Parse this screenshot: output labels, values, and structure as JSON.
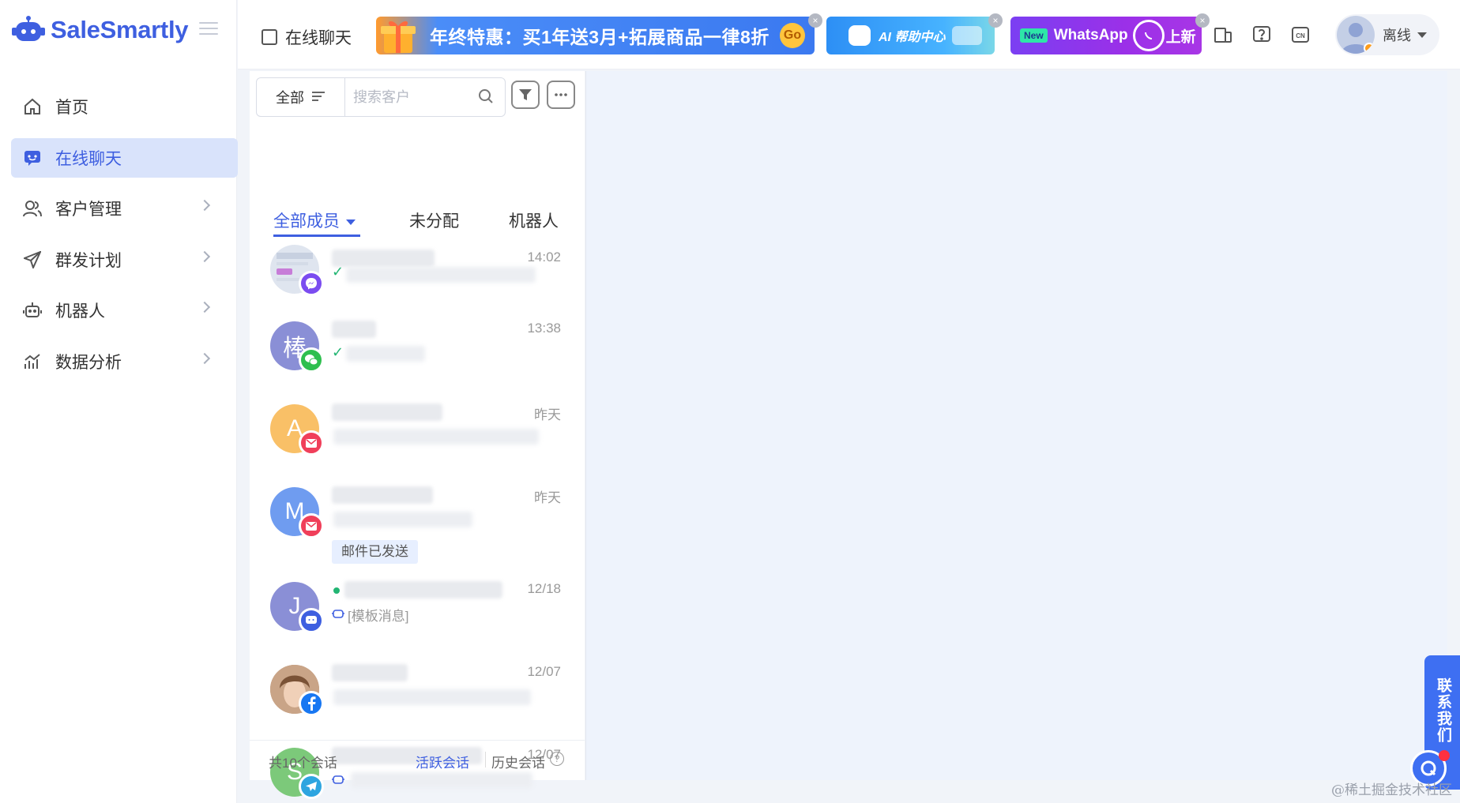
{
  "app": {
    "logo_text": "SaleSmartly",
    "accent_color": "#3e5fe0"
  },
  "sidebar": {
    "items": [
      {
        "label": "首页",
        "icon": "home-icon"
      },
      {
        "label": "在线聊天",
        "icon": "chat-icon",
        "active": true
      },
      {
        "label": "客户管理",
        "icon": "users-icon"
      },
      {
        "label": "群发计划",
        "icon": "send-icon"
      },
      {
        "label": "机器人",
        "icon": "robot-icon"
      },
      {
        "label": "数据分析",
        "icon": "chart-icon"
      }
    ]
  },
  "header": {
    "page_title": "在线聊天",
    "promo_banner": "年终特惠：买1年送3月+拓展商品一律8折",
    "promo_go": "Go",
    "ai_banner": "AI 帮助中心",
    "wa_new": "New",
    "wa_text": "WhatsApp",
    "wa_text2": "上新",
    "lang_badge": "CN",
    "user_status": "离线"
  },
  "conversation_panel": {
    "scope_label": "全部",
    "search_placeholder": "搜索客户",
    "tabs": [
      "全部成员",
      "未分配",
      "机器人"
    ],
    "conversations": [
      {
        "avatar_letter": "",
        "avatar_color": "#cfd8e8",
        "channel": "messenger-icon",
        "channel_color": "#7b4cf0",
        "time": "14:02",
        "status": "sent"
      },
      {
        "avatar_letter": "棒",
        "avatar_color": "#8a8fd6",
        "channel": "wechat-icon",
        "channel_color": "#2fbf4f",
        "time": "13:38",
        "status": "sent"
      },
      {
        "avatar_letter": "A",
        "avatar_color": "#f9c067",
        "channel": "email-icon",
        "channel_color": "#f03f5a",
        "time": "昨天"
      },
      {
        "avatar_letter": "M",
        "avatar_color": "#6f9cf0",
        "channel": "email-icon",
        "channel_color": "#f03f5a",
        "time": "昨天",
        "tag": "邮件已发送"
      },
      {
        "avatar_letter": "J",
        "avatar_color": "#8a8fd6",
        "channel": "chat-widget-icon",
        "channel_color": "#3e5fe0",
        "time": "12/18",
        "message": "[模板消息]"
      },
      {
        "avatar_letter": "",
        "avatar_color": "#b98b6c",
        "channel": "facebook-icon",
        "channel_color": "#1877f2",
        "time": "12/07"
      },
      {
        "avatar_letter": "S",
        "avatar_color": "#7cc97a",
        "channel": "telegram-icon",
        "channel_color": "#2ea5e0",
        "time": "12/07"
      }
    ],
    "footer": {
      "count": "共10个会话",
      "active_link": "活跃会话",
      "history_link": "历史会话"
    }
  },
  "contact_us": "联系我们",
  "watermark": "@稀土掘金技术社区"
}
